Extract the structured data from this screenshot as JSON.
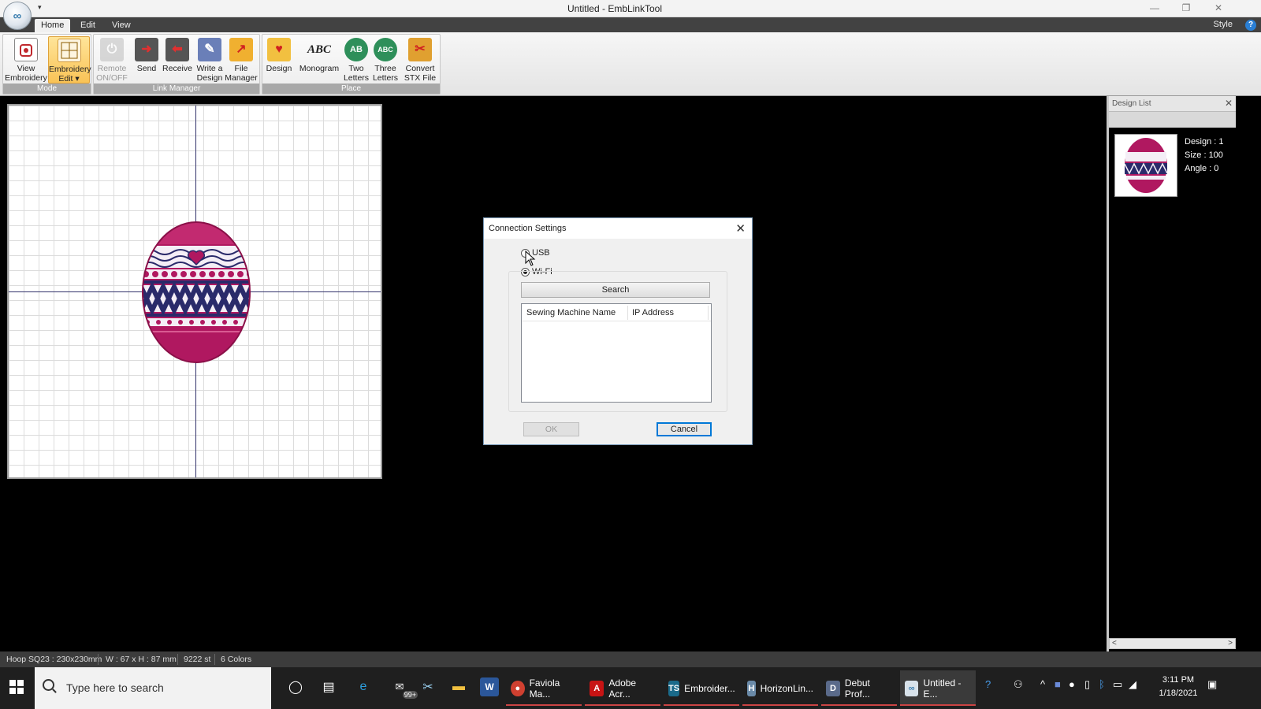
{
  "window": {
    "title": "Untitled - EmbLinkTool",
    "qat_arrow": "▾",
    "minimize": "—",
    "restore": "❐",
    "close": "✕"
  },
  "ribbon": {
    "tabs": [
      "Home",
      "Edit",
      "View"
    ],
    "style_label": "Style",
    "help_label": "?",
    "groups": {
      "mode": "Mode",
      "link_manager": "Link Manager",
      "place": "Place"
    },
    "buttons": {
      "view_embroidery": [
        "View",
        "Embroidery"
      ],
      "embroidery_edit": [
        "Embroidery",
        "Edit ▾"
      ],
      "remote_onoff": [
        "Remote",
        "ON/OFF"
      ],
      "send": [
        "Send"
      ],
      "receive": [
        "Receive"
      ],
      "write_design": [
        "Write a",
        "Design"
      ],
      "file_manager": [
        "File",
        "Manager"
      ],
      "design": [
        "Design"
      ],
      "monogram": [
        "Monogram"
      ],
      "two_letters": [
        "Two",
        "Letters"
      ],
      "three_letters": [
        "Three",
        "Letters"
      ],
      "convert_stx": [
        "Convert",
        "STX File ▾"
      ]
    },
    "icon_glyphs": {
      "monogram": "ABC",
      "two_letters": "AB",
      "three_letters": "ABC"
    }
  },
  "design_list": {
    "title": "Design List",
    "close": "✕",
    "info": [
      "Design : 1",
      "Size : 100",
      "Angle : 0"
    ],
    "scroll_left": "<",
    "scroll_right": ">"
  },
  "statusbar": {
    "hoop": "Hoop SQ23 : 230x230mm",
    "dimensions": "W : 67 x H : 87 mm",
    "stitches": "9222 st",
    "colors": "6 Colors"
  },
  "dialog": {
    "title": "Connection Settings",
    "close": "✕",
    "options": [
      "USB",
      "Wi-Fi"
    ],
    "selected_option": "Wi-Fi",
    "search_button": "Search",
    "columns": [
      "Sewing Machine Name",
      "IP Address"
    ],
    "ok_button": "OK",
    "cancel_button": "Cancel"
  },
  "taskbar": {
    "search_placeholder": "Type here to search",
    "badge_count": "99+",
    "apps": [
      "Faviola Ma...",
      "Adobe Acr...",
      "Embroider...",
      "HorizonLin...",
      "Debut Prof...",
      "Untitled - E..."
    ],
    "clock_time": "3:11 PM",
    "clock_date": "1/18/2021"
  },
  "colors": {
    "egg_magenta": "#b01860",
    "egg_navy": "#2a2a6a",
    "hoop_axis": "#33336b",
    "ribbon_selected": "#f9c356",
    "accent_blue": "#0078d7"
  }
}
